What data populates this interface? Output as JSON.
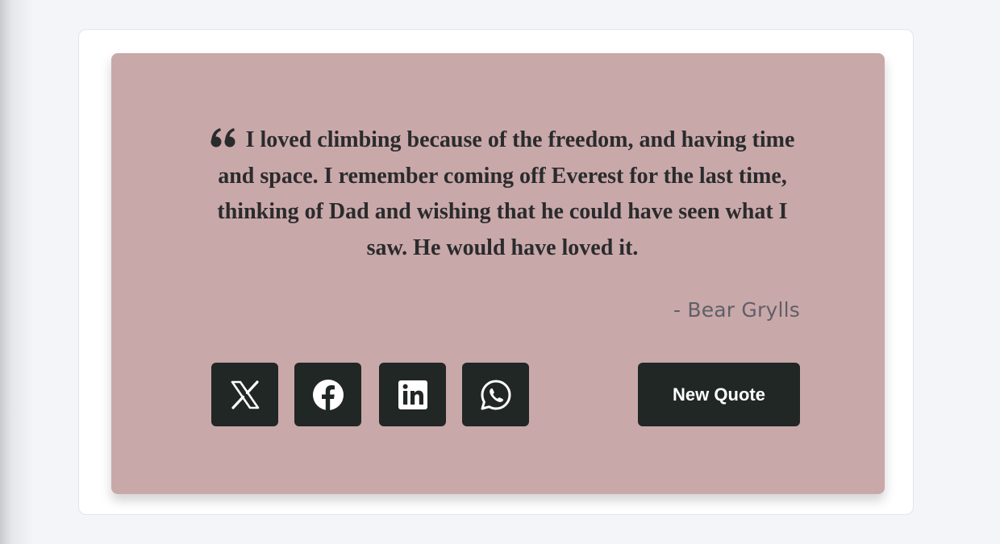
{
  "quote": {
    "text": "I loved climbing because of the freedom, and having time and space. I remember coming off Everest for the last time, thinking of Dad and wishing that he could have seen what I saw. He would have loved it.",
    "author": "- Bear Grylls",
    "quote_icon": "quote-left-icon"
  },
  "share": {
    "buttons": [
      {
        "icon": "x-twitter-icon"
      },
      {
        "icon": "facebook-icon"
      },
      {
        "icon": "linkedin-icon"
      },
      {
        "icon": "whatsapp-icon"
      }
    ]
  },
  "actions": {
    "new_quote_label": "New Quote"
  },
  "colors": {
    "page_background": "#f4f5f8",
    "card_background": "#ffffff",
    "quote_background": "#c9a8aa",
    "button_background": "#212724",
    "quote_text": "#2a2b2c",
    "author_text": "#5f6066"
  }
}
